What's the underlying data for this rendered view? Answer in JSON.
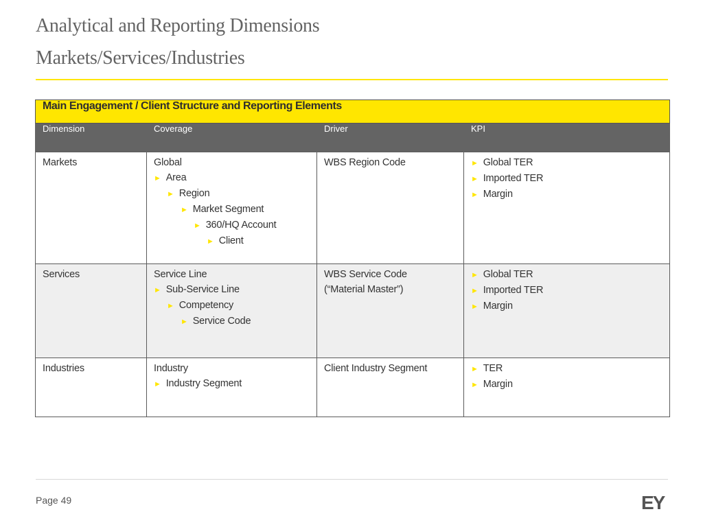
{
  "header": {
    "title_line1": "Analytical and Reporting Dimensions",
    "title_line2": "Markets/Services/Industries"
  },
  "table": {
    "banner": "Main Engagement / Client Structure and Reporting Elements",
    "columns": [
      "Dimension",
      "Coverage",
      "Driver",
      "KPI"
    ],
    "bullet_glyph": "►",
    "rows": [
      {
        "dimension": "Markets",
        "coverage": [
          {
            "text": "Global",
            "level": 1,
            "bullet": false
          },
          {
            "text": "Area",
            "level": 2,
            "bullet": true
          },
          {
            "text": "Region",
            "level": 3,
            "bullet": true
          },
          {
            "text": "Market Segment",
            "level": 4,
            "bullet": true
          },
          {
            "text": "360/HQ Account",
            "level": 5,
            "bullet": true
          },
          {
            "text": "Client",
            "level": 6,
            "bullet": true
          }
        ],
        "driver": [
          "WBS Region Code"
        ],
        "kpi": [
          "Global TER",
          "Imported TER",
          "Margin"
        ]
      },
      {
        "dimension": "Services",
        "coverage": [
          {
            "text": "Service Line",
            "level": 1,
            "bullet": false
          },
          {
            "text": "Sub-Service Line",
            "level": 2,
            "bullet": true
          },
          {
            "text": "Competency",
            "level": 3,
            "bullet": true
          },
          {
            "text": "Service Code",
            "level": 4,
            "bullet": true
          }
        ],
        "driver": [
          "WBS Service Code",
          "(“Material Master”)"
        ],
        "kpi": [
          "Global TER",
          "Imported TER",
          "Margin"
        ]
      },
      {
        "dimension": "Industries",
        "coverage": [
          {
            "text": "Industry",
            "level": 1,
            "bullet": false
          },
          {
            "text": "Industry Segment",
            "level": 2,
            "bullet": true
          }
        ],
        "driver": [
          "Client Industry Segment"
        ],
        "kpi": [
          "TER",
          "Margin"
        ]
      }
    ]
  },
  "footer": {
    "page_label": "Page 49",
    "logo_text": "EY"
  },
  "colors": {
    "accent_yellow": "#ffe600",
    "header_gray": "#646464",
    "alt_row": "#efefef"
  }
}
